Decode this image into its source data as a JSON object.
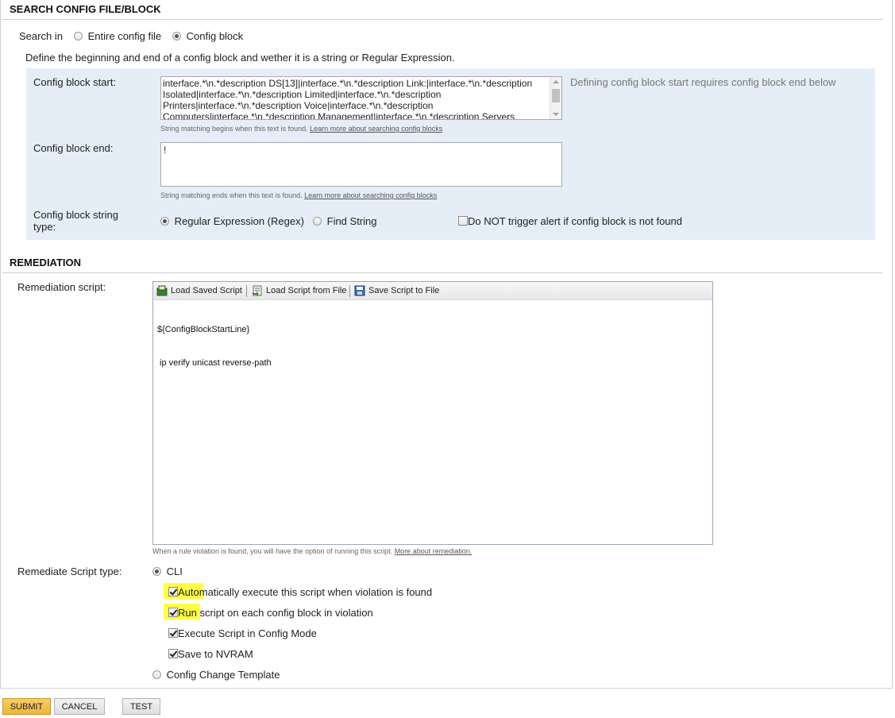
{
  "search": {
    "title": "SEARCH CONFIG FILE/BLOCK",
    "search_in_label": "Search in",
    "option_entire": "Entire config file",
    "option_block": "Config block",
    "description": "Define the beginning and end of a config block and wether it is a string or Regular Expression.",
    "block_start_label": "Config block start:",
    "block_start_lines": [
      "interface.*\\n.*description DS[13]|interface.*\\n.*description Link:|interface.*\\n.*description",
      "Isolated|interface.*\\n.*description Limited|interface.*\\n.*description",
      "Printers|interface.*\\n.*description Voice|interface.*\\n.*description",
      "Computers|interface.*\\n.*description Management|interface.*\\n.*description Servers"
    ],
    "block_start_note": "Defining config block start requires config block end below",
    "block_start_hint": "String matching begins when this text is found.",
    "block_start_hint_link": "Learn more about searching config blocks",
    "block_end_label": "Config block end:",
    "block_end_value": "!",
    "block_end_hint": "String matching ends when this text is found.",
    "block_end_hint_link": "Learn more about searching config blocks",
    "string_type_label_1": "Config block string",
    "string_type_label_2": "type:",
    "option_regex": "Regular Expression (Regex)",
    "option_find": "Find String",
    "no_trigger_label": "Do NOT trigger alert if config block is not found"
  },
  "remediation": {
    "title": "REMEDIATION",
    "script_label": "Remediation script:",
    "toolbar": {
      "load_saved": "Load Saved Script",
      "load_file": "Load Script from File",
      "save_file": "Save Script to File"
    },
    "script_lines": [
      "${ConfigBlockStartLine}",
      " ip verify unicast reverse-path"
    ],
    "script_hint": "When a rule violation is found, you will have the option of running this script.",
    "script_hint_link": "More about remediation.",
    "type_label": "Remediate Script type:",
    "option_cli": "CLI",
    "auto_exec_hl": "Autom",
    "auto_exec_rest": "atically execute this script when violation is found",
    "run_each_hl": "Run",
    "run_each_rest": " script on each config block in violation",
    "config_mode": "Execute Script in Config Mode",
    "save_nvram": "Save to NVRAM",
    "option_template": "Config Change Template"
  },
  "buttons": {
    "submit": "SUBMIT",
    "cancel": "CANCEL",
    "test": "TEST"
  }
}
